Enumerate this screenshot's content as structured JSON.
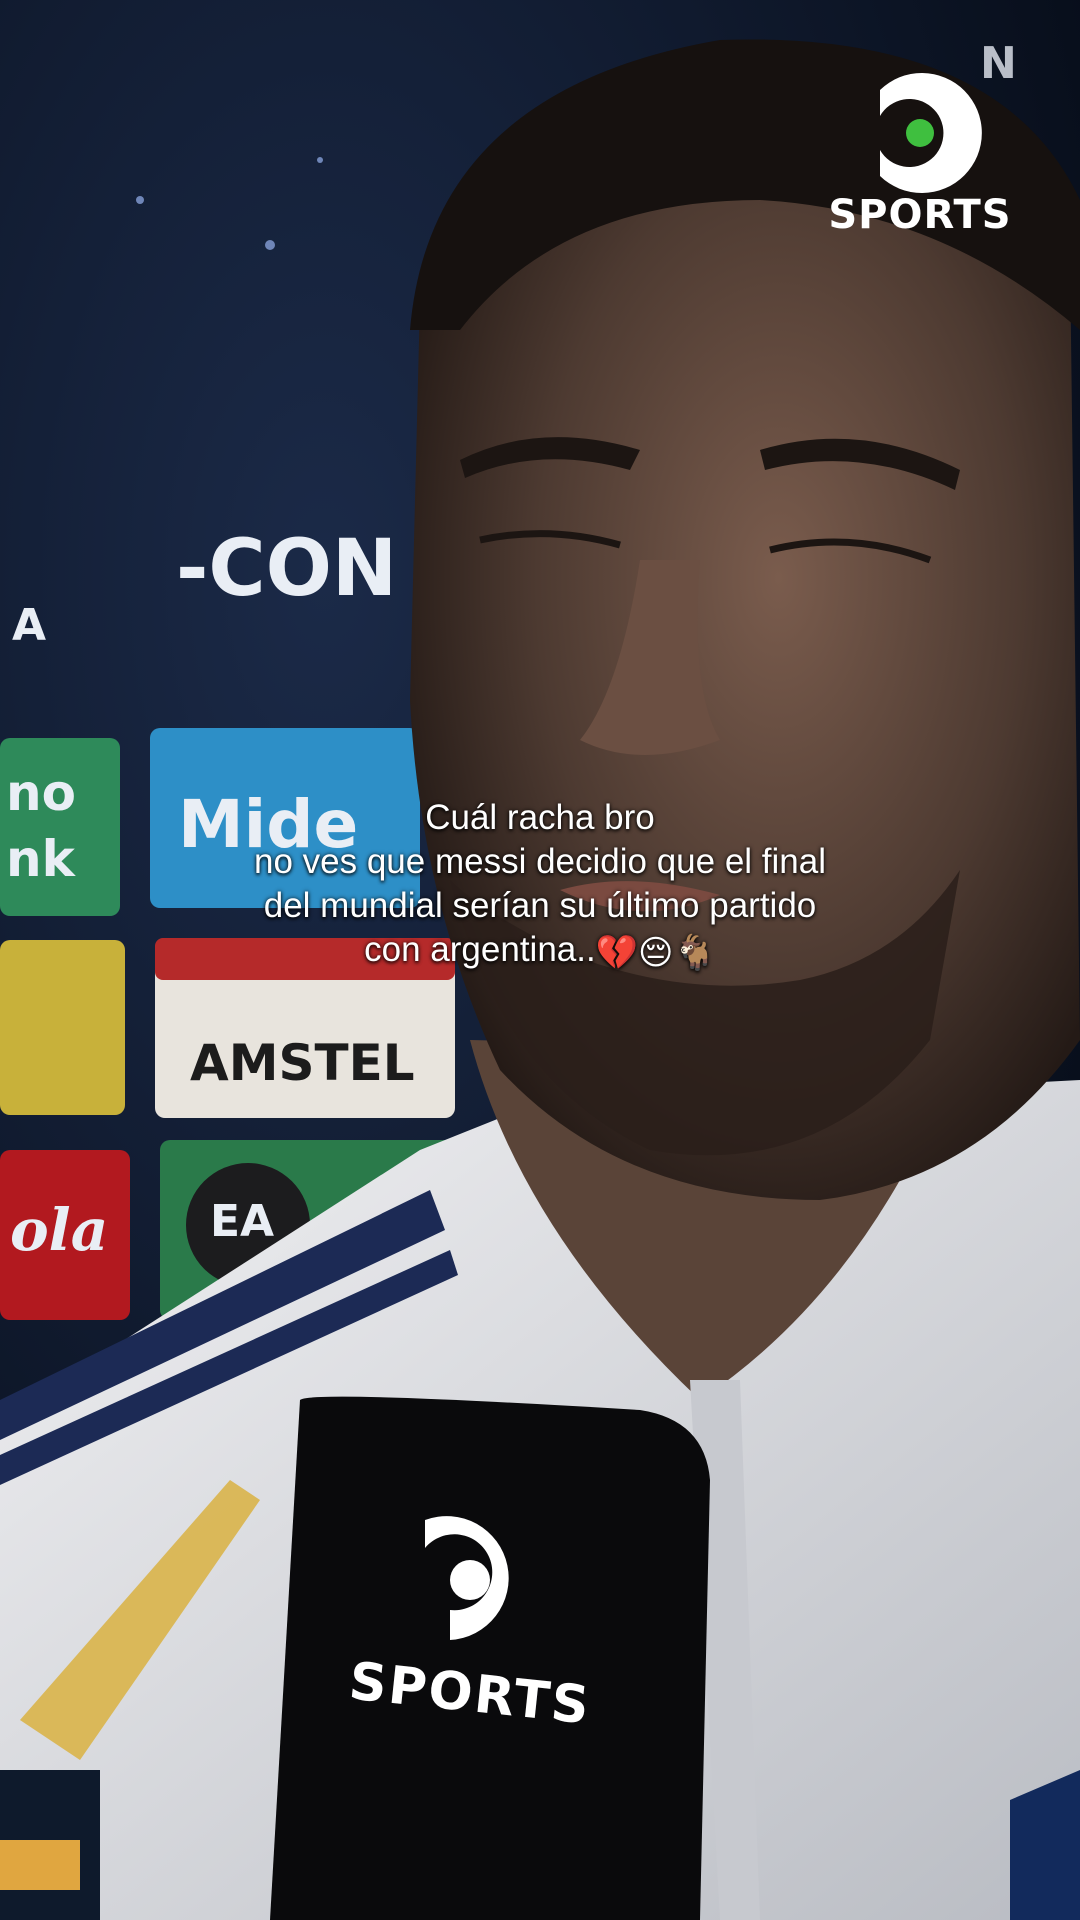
{
  "caption": {
    "line1": "Cuál racha bro",
    "line2": "no ves que messi decidio que el final",
    "line3": "del mundial serían su último partido",
    "line4_text": "con argentina..",
    "line4_emojis": "💔😔🐐"
  },
  "overlay": {
    "broadcaster_logo_text": "SPORTS",
    "corner_letter": "N",
    "mic_logo_text": "SPORTS"
  },
  "background_boards": {
    "conmebol_fragment": "-CON",
    "letter_a": "A",
    "sponsor_mide": "Mide",
    "sponsor_amstel": "AMSTEL",
    "sponsor_coca": "ola",
    "sponsor_ea": "EA",
    "sponsor_bank_top": "no",
    "sponsor_bank_bottom": "nk"
  },
  "colors": {
    "backdrop": "#0d1b33",
    "caption_text": "#ffffff",
    "jersey": "#e8e9ec",
    "mic": "#0a0a0c",
    "logo_dot": "#3fbf3f"
  }
}
